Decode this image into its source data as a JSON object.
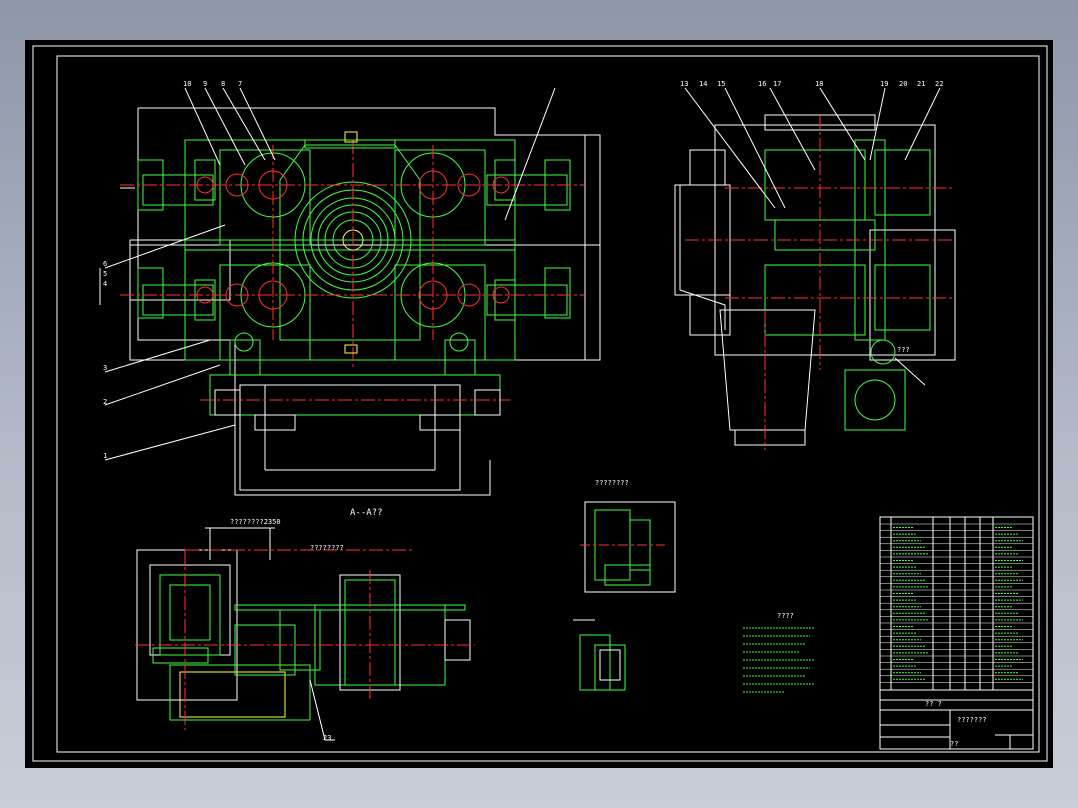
{
  "drawing": {
    "section_title": "A--A??",
    "detail_label": "????????",
    "section_dim_text": "????????",
    "section_a_label": "????????2350",
    "left_callouts": [
      "10",
      "9",
      "8",
      "7",
      "6",
      "5",
      "4",
      "3",
      "2",
      "1"
    ],
    "right_callouts": [
      "13",
      "14",
      "15",
      "16",
      "17",
      "18",
      "19",
      "20",
      "21",
      "22"
    ],
    "callout_23": "23",
    "small_label_right": "???",
    "tech_title": "????",
    "title_block_name": "???????",
    "title_block_code": "??",
    "scale_label": "?? ?",
    "colors": {
      "line_white": "#ffffff",
      "line_green": "#40ff40",
      "line_red": "#ff3030",
      "line_yellow": "#ffff40",
      "background": "#000000"
    }
  }
}
